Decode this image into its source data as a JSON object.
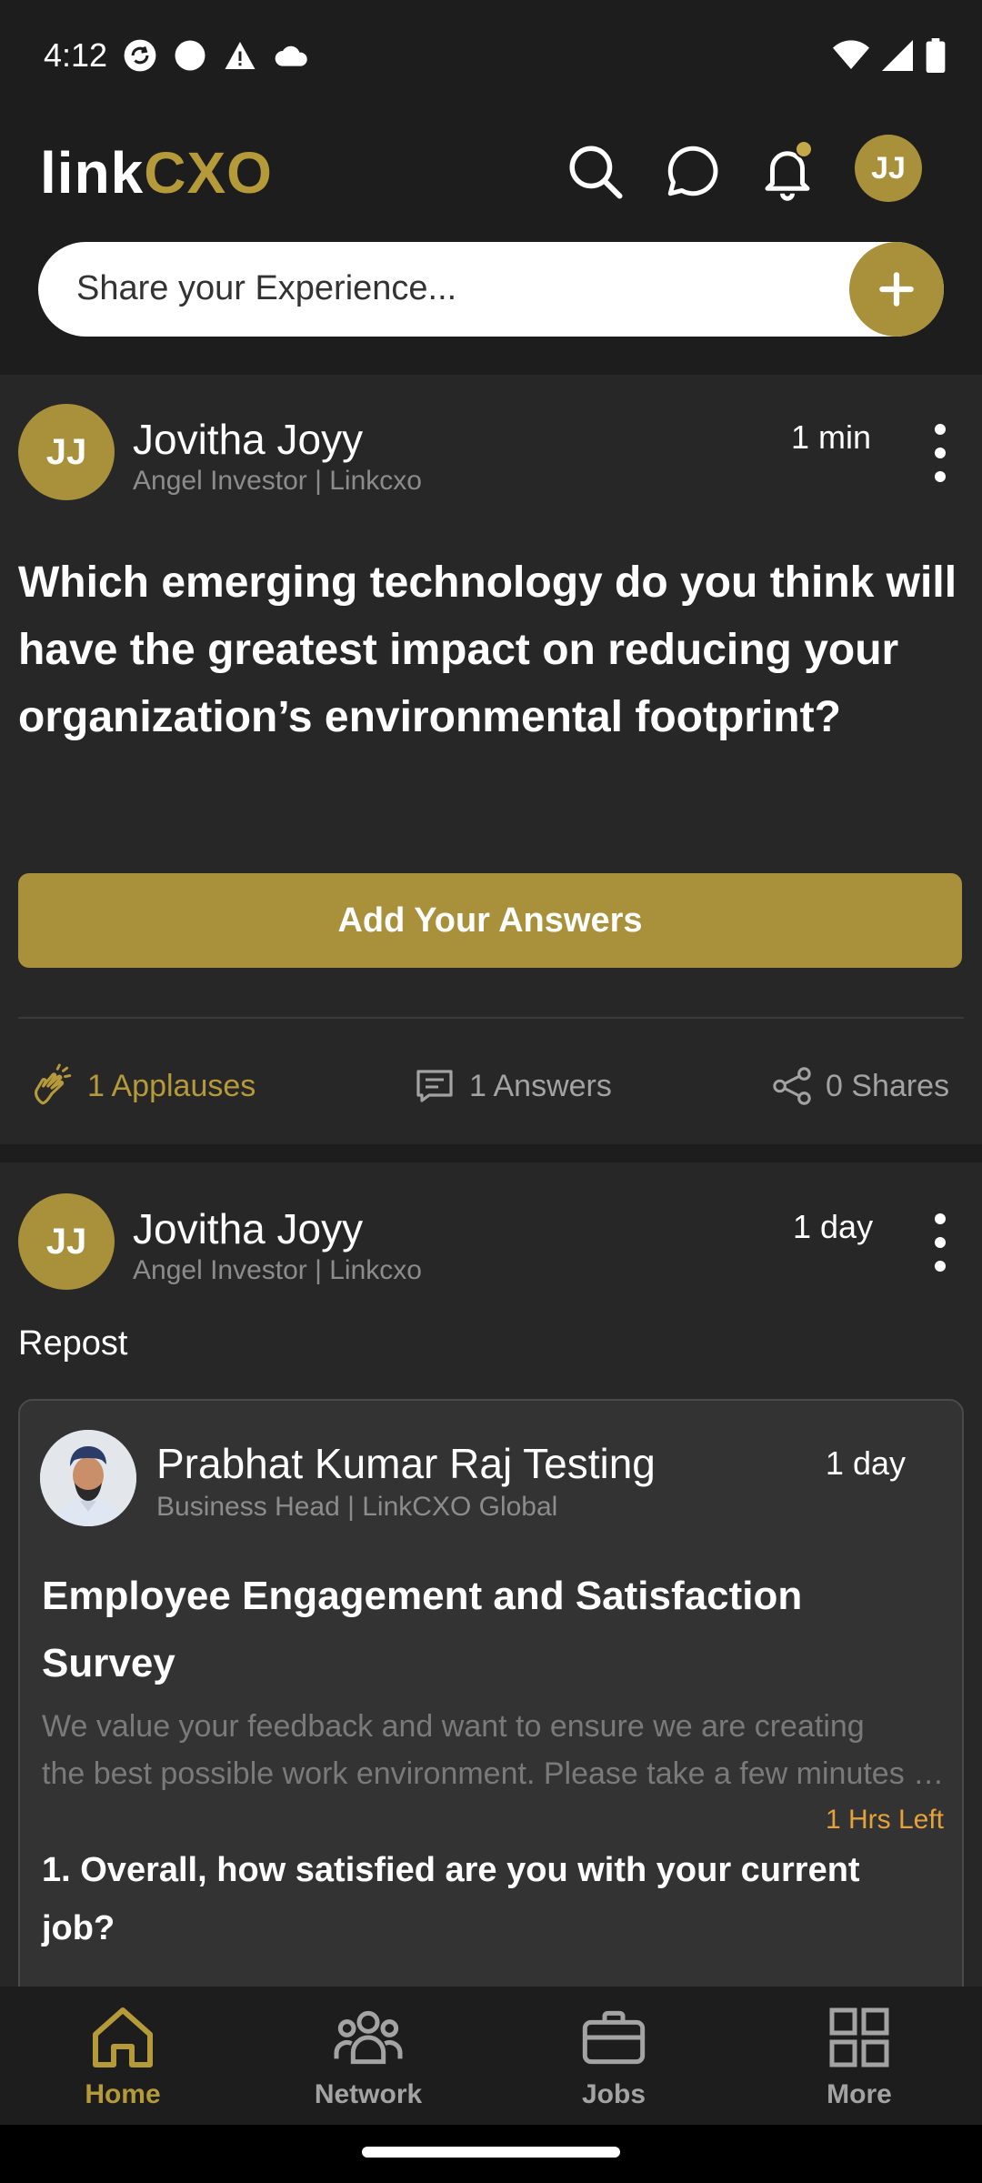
{
  "status_bar": {
    "time": "4:12"
  },
  "header": {
    "logo": {
      "part1": "link",
      "part2": "CXO"
    },
    "avatar_initials": "JJ"
  },
  "share": {
    "placeholder": "Share your Experience..."
  },
  "posts": [
    {
      "avatar_initials": "JJ",
      "author": "Jovitha Joyy",
      "author_title": "Angel Investor | Linkcxo",
      "time": "1 min",
      "question": "Which emerging technology do you think will have the greatest impact on reducing your organization’s environmental footprint?",
      "answer_button": "Add Your Answers",
      "applauses": "1 Applauses",
      "answers": "1 Answers",
      "shares": "0 Shares"
    },
    {
      "avatar_initials": "JJ",
      "author": "Jovitha Joyy",
      "author_title": "Angel Investor | Linkcxo",
      "time": "1 day",
      "repost_label": "Repost",
      "repost": {
        "author": "Prabhat Kumar Raj Testing",
        "author_title": "Business Head | LinkCXO Global",
        "time": "1 day",
        "title": "Employee Engagement and Satisfaction Survey",
        "description_line1": "We value your feedback and want to ensure we are creating",
        "description_line2": "the best possible work environment. Please take a few minutes to complete this survey",
        "time_left": "1 Hrs Left",
        "question": "1. Overall, how satisfied are you with your current job?"
      }
    }
  ],
  "bottom_nav": [
    {
      "label": "Home",
      "icon": "home-icon",
      "active": true
    },
    {
      "label": "Network",
      "icon": "network-icon",
      "active": false
    },
    {
      "label": "Jobs",
      "icon": "briefcase-icon",
      "active": false
    },
    {
      "label": "More",
      "icon": "grid-icon",
      "active": false
    }
  ],
  "colors": {
    "accent": "#a8913a",
    "accent_text": "#b59a3a",
    "background": "#1d1d1d",
    "card": "#272727",
    "time_left": "#e4a23a"
  }
}
